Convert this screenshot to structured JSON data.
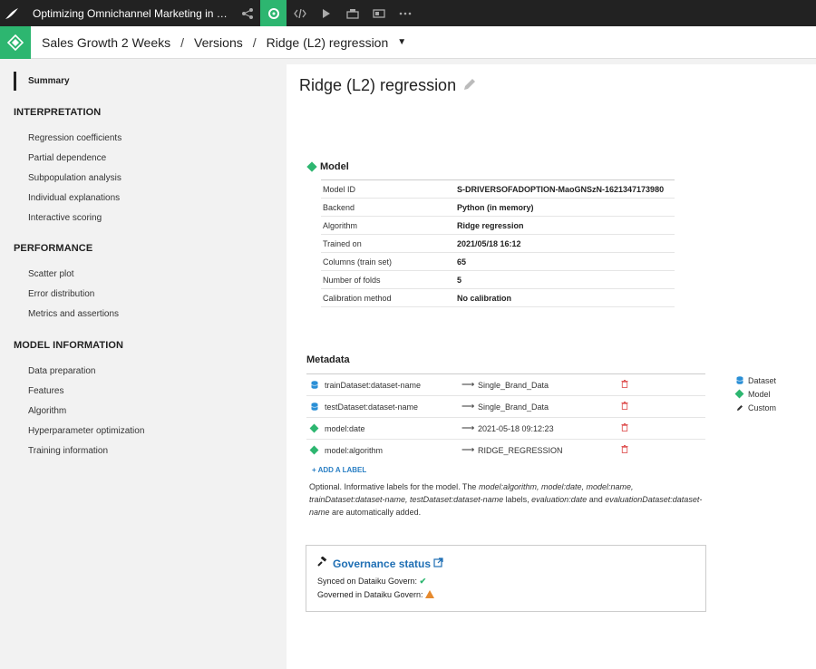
{
  "topbar": {
    "project_title": "Optimizing Omnichannel Marketing in Pha...",
    "icons": [
      "flow-icon",
      "lab-icon",
      "code-icon",
      "run-icon",
      "deploy-icon",
      "dashboard-icon",
      "more-icon"
    ],
    "accent": "#2db670"
  },
  "breadcrumb": {
    "items": [
      "Sales Growth 2 Weeks",
      "Versions",
      "Ridge (L2) regression"
    ],
    "separator": "/"
  },
  "sidebar": {
    "summary": "Summary",
    "sections": [
      {
        "title": "INTERPRETATION",
        "items": [
          "Regression coefficients",
          "Partial dependence",
          "Subpopulation analysis",
          "Individual explanations",
          "Interactive scoring"
        ]
      },
      {
        "title": "PERFORMANCE",
        "items": [
          "Scatter plot",
          "Error distribution",
          "Metrics and assertions"
        ]
      },
      {
        "title": "MODEL INFORMATION",
        "items": [
          "Data preparation",
          "Features",
          "Algorithm",
          "Hyperparameter optimization",
          "Training information"
        ]
      }
    ]
  },
  "main": {
    "title": "Ridge (L2) regression",
    "model": {
      "heading": "Model",
      "rows": [
        {
          "key": "Model ID",
          "value": "S-DRIVERSOFADOPTION-MaoGNSzN-1621347173980"
        },
        {
          "key": "Backend",
          "value": "Python (in memory)"
        },
        {
          "key": "Algorithm",
          "value": "Ridge regression"
        },
        {
          "key": "Trained on",
          "value": "2021/05/18 16:12"
        },
        {
          "key": "Columns (train set)",
          "value": "65"
        },
        {
          "key": "Number of folds",
          "value": "5"
        },
        {
          "key": "Calibration method",
          "value": "No calibration"
        }
      ]
    },
    "metadata": {
      "heading": "Metadata",
      "rows": [
        {
          "icon": "dataset",
          "key": "trainDataset:dataset-name",
          "value": "Single_Brand_Data"
        },
        {
          "icon": "dataset",
          "key": "testDataset:dataset-name",
          "value": "Single_Brand_Data"
        },
        {
          "icon": "model",
          "key": "model:date",
          "value": "2021-05-18 09:12:23"
        },
        {
          "icon": "model",
          "key": "model:algorithm",
          "value": "RIDGE_REGRESSION"
        }
      ],
      "add_label": "ADD A LABEL",
      "optional_text": {
        "p1": "Optional. Informative labels for the model. The ",
        "i1": "model:algorithm, model:date, model:name, trainDataset:dataset-name, testDataset:dataset-name",
        "p2": " labels, ",
        "i2": "evaluation:date",
        "p3": " and ",
        "i3": "evaluationDataset:dataset-name",
        "p4": " are automatically added."
      },
      "legend": [
        "Dataset",
        "Model",
        "Custom"
      ]
    },
    "governance": {
      "title": "Governance status",
      "synced_label": "Synced on Dataiku Govern:",
      "governed_label": "Governed in Dataiku Govern:"
    }
  }
}
